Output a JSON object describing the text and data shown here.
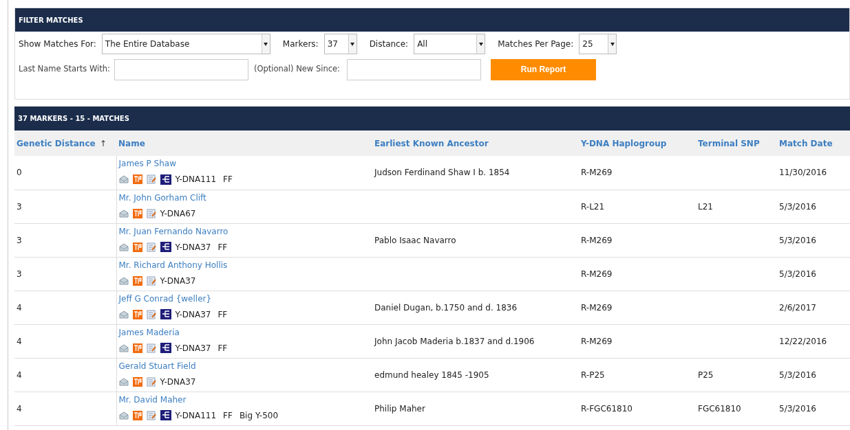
{
  "filter_panel": {
    "title": "FILTER MATCHES",
    "show_matches_for": {
      "label": "Show Matches For:",
      "value": "The Entire Database"
    },
    "markers": {
      "label": "Markers:",
      "value": "37"
    },
    "distance": {
      "label": "Distance:",
      "value": "All"
    },
    "matches_per_page": {
      "label": "Matches Per Page:",
      "value": "25"
    },
    "last_name": {
      "label": "Last Name Starts With:"
    },
    "new_since": {
      "label": "(Optional) New Since:"
    },
    "run_button": "Run Report"
  },
  "results": {
    "title": "37 MARKERS - 15 - MATCHES",
    "columns": [
      {
        "label": "Genetic Distance",
        "sort_arrow": "↑"
      },
      {
        "label": "Name"
      },
      {
        "label": "Earliest Known Ancestor"
      },
      {
        "label": "Y-DNA Haplogroup"
      },
      {
        "label": "Terminal SNP"
      },
      {
        "label": "Match Date"
      }
    ],
    "rows": [
      {
        "distance": "0",
        "name": "James P Shaw",
        "tree": true,
        "tags": [
          "Y-DNA111",
          "FF"
        ],
        "ancestor": "Judson Ferdinand Shaw I b. 1854",
        "haplogroup": "R-M269",
        "snp": "",
        "date": "11/30/2016"
      },
      {
        "distance": "3",
        "name": "Mr. John Gorham Clift",
        "tree": false,
        "tags": [
          "Y-DNA67"
        ],
        "ancestor": "",
        "haplogroup": "R-L21",
        "snp": "L21",
        "date": "5/3/2016"
      },
      {
        "distance": "3",
        "name": "Mr. Juan Fernando Navarro",
        "tree": true,
        "tags": [
          "Y-DNA37",
          "FF"
        ],
        "ancestor": "Pablo Isaac Navarro",
        "haplogroup": "R-M269",
        "snp": "",
        "date": "5/3/2016"
      },
      {
        "distance": "3",
        "name": "Mr. Richard Anthony Hollis",
        "tree": false,
        "tags": [
          "Y-DNA37"
        ],
        "ancestor": "",
        "haplogroup": "R-M269",
        "snp": "",
        "date": "5/3/2016"
      },
      {
        "distance": "4",
        "name": "Jeff G Conrad {weller}",
        "tree": true,
        "tags": [
          "Y-DNA37",
          "FF"
        ],
        "ancestor": "Daniel Dugan, b.1750 and d. 1836",
        "haplogroup": "R-M269",
        "snp": "",
        "date": "2/6/2017"
      },
      {
        "distance": "4",
        "name": "James Maderia",
        "tree": true,
        "tags": [
          "Y-DNA37",
          "FF"
        ],
        "ancestor": "John Jacob Maderia b.1837 and d.1906",
        "haplogroup": "R-M269",
        "snp": "",
        "date": "12/22/2016"
      },
      {
        "distance": "4",
        "name": "Gerald Stuart Field",
        "tree": false,
        "tags": [
          "Y-DNA37"
        ],
        "ancestor": "edmund healey 1845 -1905",
        "haplogroup": "R-P25",
        "snp": "P25",
        "date": "5/3/2016"
      },
      {
        "distance": "4",
        "name": "Mr. David Maher",
        "tree": true,
        "tags": [
          "Y-DNA111",
          "FF",
          "Big Y-500"
        ],
        "ancestor": "Philip Maher",
        "haplogroup": "R-FGC61810",
        "snp": "FGC61810",
        "date": "5/3/2016"
      }
    ]
  }
}
